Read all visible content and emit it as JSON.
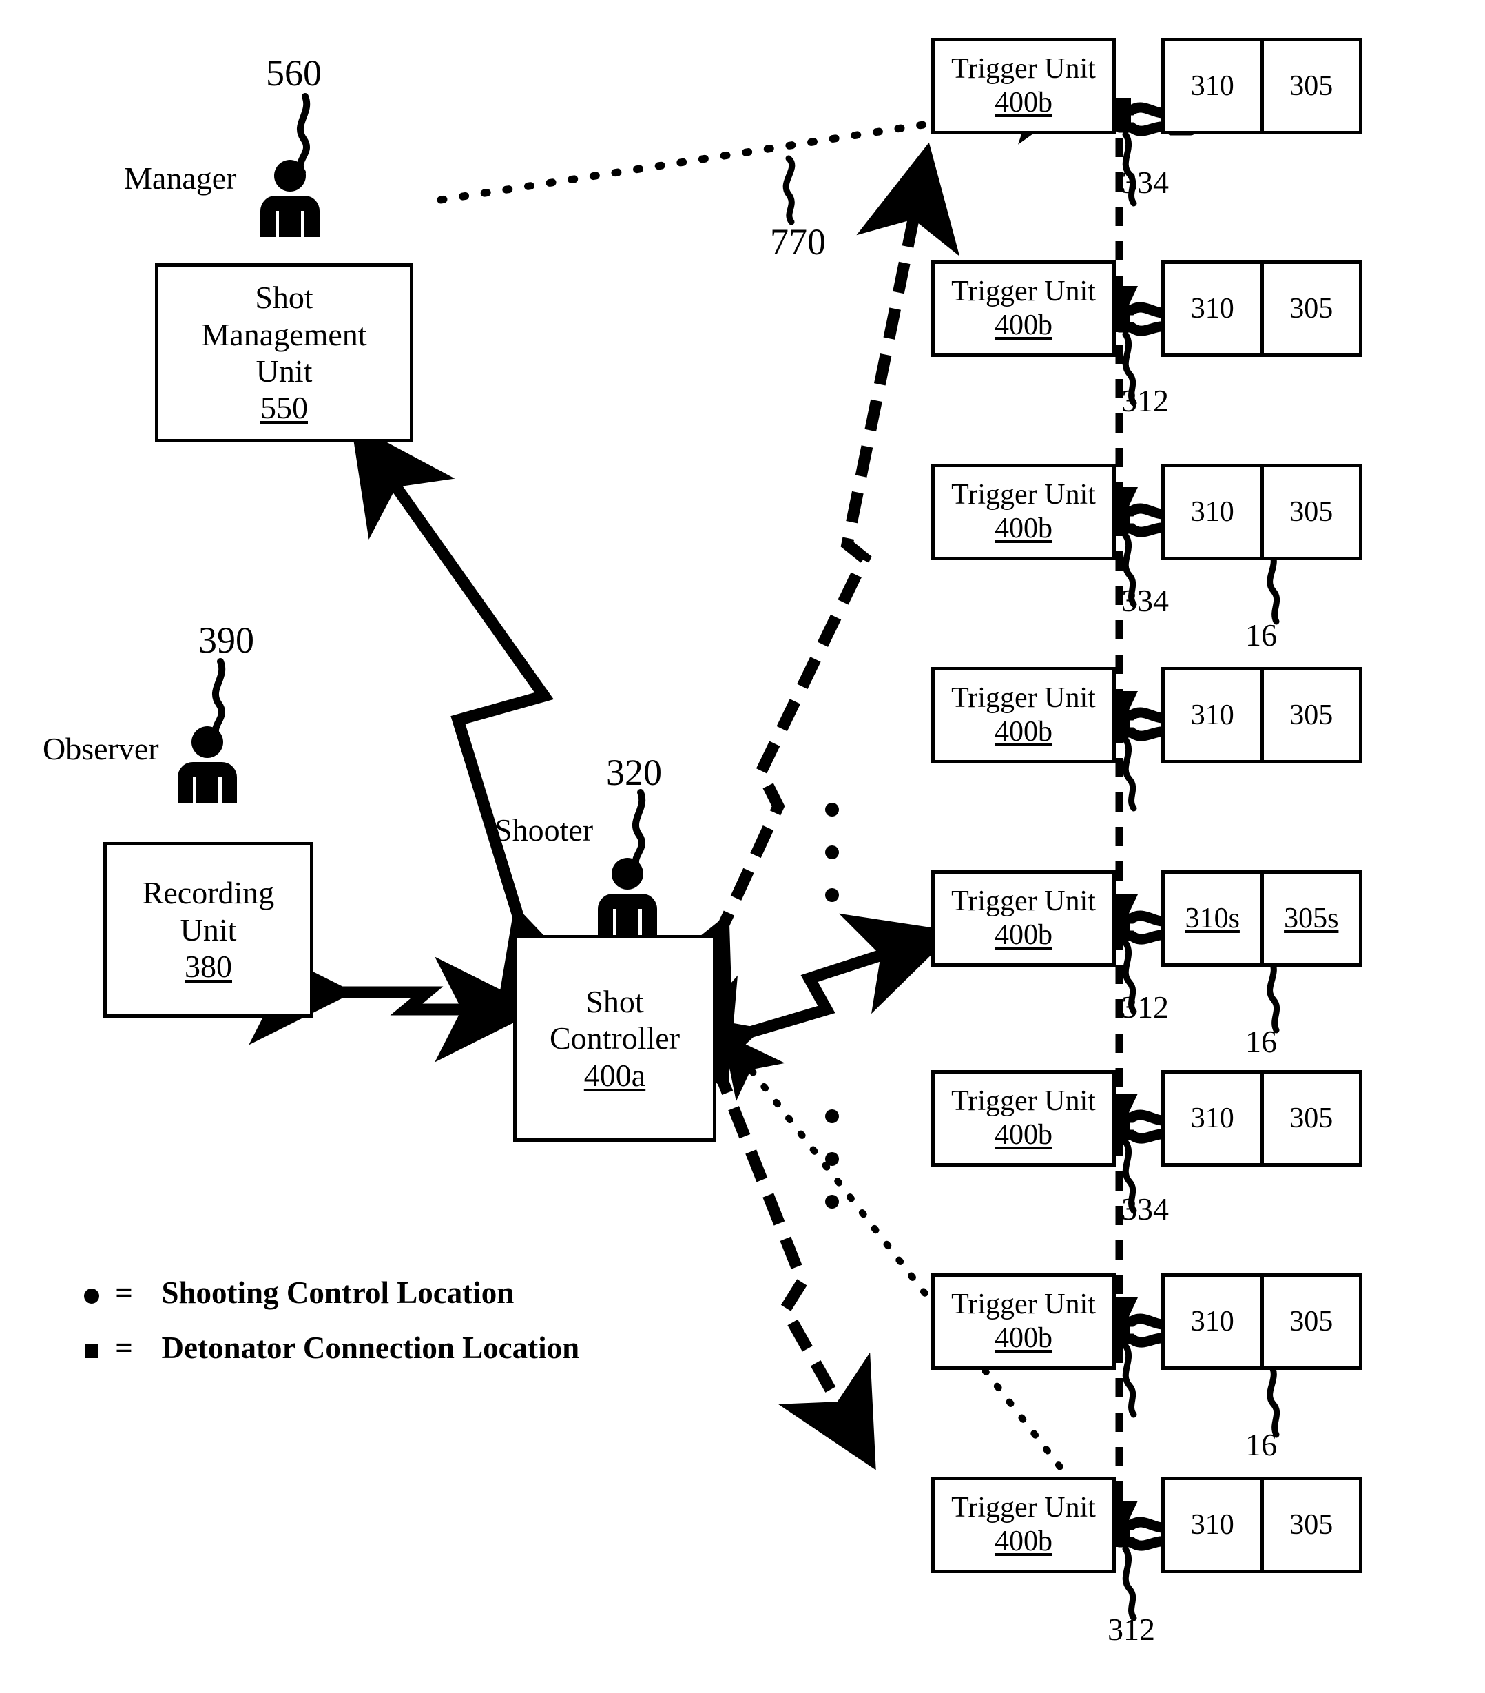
{
  "figure": {
    "title": "Shot control system block diagram",
    "background": "#ffffff",
    "ink": "#000000"
  },
  "people": [
    {
      "role": "Manager",
      "ref": "560"
    },
    {
      "role": "Observer",
      "ref": "390"
    },
    {
      "role": "Shooter",
      "ref": "320"
    }
  ],
  "boxes": {
    "shot_management_unit": {
      "lines": [
        "Shot",
        "Management",
        "Unit"
      ],
      "ref": "550"
    },
    "recording_unit": {
      "lines": [
        "Recording",
        "Unit"
      ],
      "ref": "380"
    },
    "shot_controller": {
      "lines": [
        "Shot",
        "Controller"
      ],
      "ref": "400a"
    }
  },
  "trigger_units": [
    {
      "label": "Trigger Unit",
      "ref": "400b",
      "detonators": [
        "310",
        "305"
      ],
      "cable_ref": "334",
      "det_ref": ""
    },
    {
      "label": "Trigger Unit",
      "ref": "400b",
      "detonators": [
        "310",
        "305"
      ],
      "cable_ref": "312",
      "det_ref": ""
    },
    {
      "label": "Trigger Unit",
      "ref": "400b",
      "detonators": [
        "310",
        "305"
      ],
      "cable_ref": "334",
      "det_ref": "16"
    },
    {
      "label": "Trigger Unit",
      "ref": "400b",
      "detonators": [
        "310",
        "305"
      ],
      "cable_ref": "",
      "det_ref": ""
    },
    {
      "label": "Trigger Unit",
      "ref": "400b",
      "detonators": [
        "310s",
        "305s"
      ],
      "cable_ref": "312",
      "det_ref": "16"
    },
    {
      "label": "Trigger Unit",
      "ref": "400b",
      "detonators": [
        "310",
        "305"
      ],
      "cable_ref": "334",
      "det_ref": ""
    },
    {
      "label": "Trigger Unit",
      "ref": "400b",
      "detonators": [
        "310",
        "305"
      ],
      "cable_ref": "",
      "det_ref": "16"
    },
    {
      "label": "Trigger Unit",
      "ref": "400b",
      "detonators": [
        "310",
        "305"
      ],
      "cable_ref": "312",
      "det_ref": ""
    }
  ],
  "link_labels": {
    "dotted_long_link": "770"
  },
  "legend": {
    "items": [
      {
        "marker": "circle-marker",
        "eq": "=",
        "text": "Shooting Control Location"
      },
      {
        "marker": "square-marker",
        "eq": "=",
        "text": "Detonator Connection Location"
      }
    ]
  },
  "ellipses": {
    "upper": "vertical-ellipsis",
    "lower": "vertical-ellipsis"
  }
}
